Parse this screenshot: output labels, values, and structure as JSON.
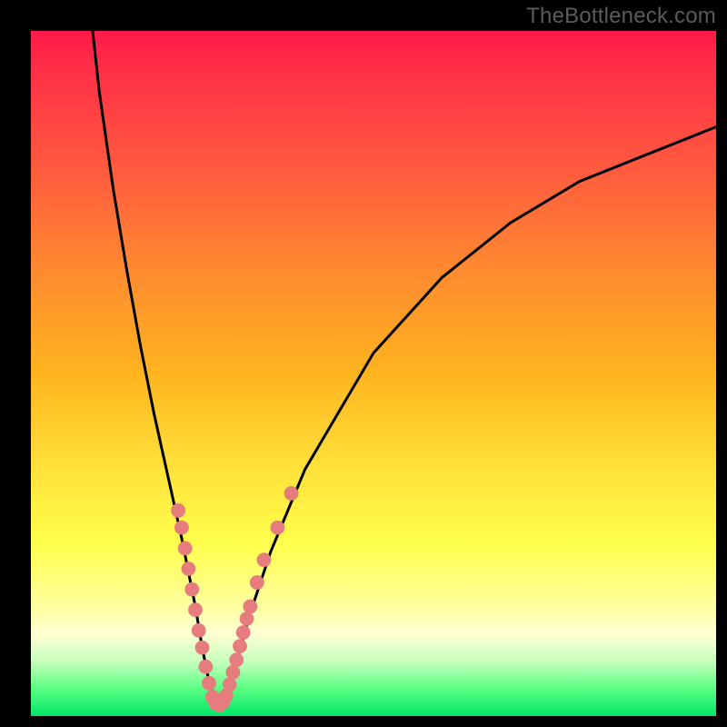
{
  "watermark": "TheBottleneck.com",
  "chart_data": {
    "type": "line",
    "title": "",
    "xlabel": "",
    "ylabel": "",
    "xlim": [
      0,
      100
    ],
    "ylim": [
      0,
      100
    ],
    "series": [
      {
        "name": "curve",
        "x": [
          9,
          10,
          12,
          14,
          16,
          18,
          20,
          22,
          23,
          24,
          25,
          26,
          27,
          28,
          29,
          30,
          32,
          35,
          40,
          50,
          60,
          70,
          80,
          90,
          100
        ],
        "y": [
          100,
          91,
          77,
          65,
          54,
          44,
          35,
          26,
          21,
          16,
          10,
          5,
          2,
          2,
          4,
          8,
          15,
          24,
          36,
          53,
          64,
          72,
          78,
          82,
          86
        ]
      }
    ],
    "markers": [
      {
        "x": 21.5,
        "y": 30.0,
        "r": 1.4
      },
      {
        "x": 22.0,
        "y": 27.5,
        "r": 1.4
      },
      {
        "x": 22.5,
        "y": 24.5,
        "r": 1.4
      },
      {
        "x": 23.0,
        "y": 21.5,
        "r": 1.4
      },
      {
        "x": 23.5,
        "y": 18.5,
        "r": 1.4
      },
      {
        "x": 24.0,
        "y": 15.5,
        "r": 1.4
      },
      {
        "x": 24.5,
        "y": 12.5,
        "r": 1.4
      },
      {
        "x": 25.0,
        "y": 10.0,
        "r": 1.4
      },
      {
        "x": 25.5,
        "y": 7.2,
        "r": 1.4
      },
      {
        "x": 26.0,
        "y": 4.8,
        "r": 1.4
      },
      {
        "x": 26.5,
        "y": 2.8,
        "r": 1.4
      },
      {
        "x": 27.0,
        "y": 1.8,
        "r": 1.4
      },
      {
        "x": 27.5,
        "y": 1.6,
        "r": 1.4
      },
      {
        "x": 28.0,
        "y": 2.0,
        "r": 1.4
      },
      {
        "x": 28.5,
        "y": 3.0,
        "r": 1.4
      },
      {
        "x": 29.0,
        "y": 4.6,
        "r": 1.4
      },
      {
        "x": 29.5,
        "y": 6.4,
        "r": 1.4
      },
      {
        "x": 30.0,
        "y": 8.2,
        "r": 1.4
      },
      {
        "x": 30.5,
        "y": 10.2,
        "r": 1.4
      },
      {
        "x": 31.0,
        "y": 12.2,
        "r": 1.4
      },
      {
        "x": 31.5,
        "y": 14.2,
        "r": 1.4
      },
      {
        "x": 32.0,
        "y": 16.0,
        "r": 1.4
      },
      {
        "x": 33.0,
        "y": 19.5,
        "r": 1.4
      },
      {
        "x": 34.0,
        "y": 22.8,
        "r": 1.4
      },
      {
        "x": 36.0,
        "y": 27.5,
        "r": 1.4
      },
      {
        "x": 38.0,
        "y": 32.5,
        "r": 1.4
      }
    ],
    "marker_color": "#e77c7e",
    "curve_color": "#000000"
  }
}
